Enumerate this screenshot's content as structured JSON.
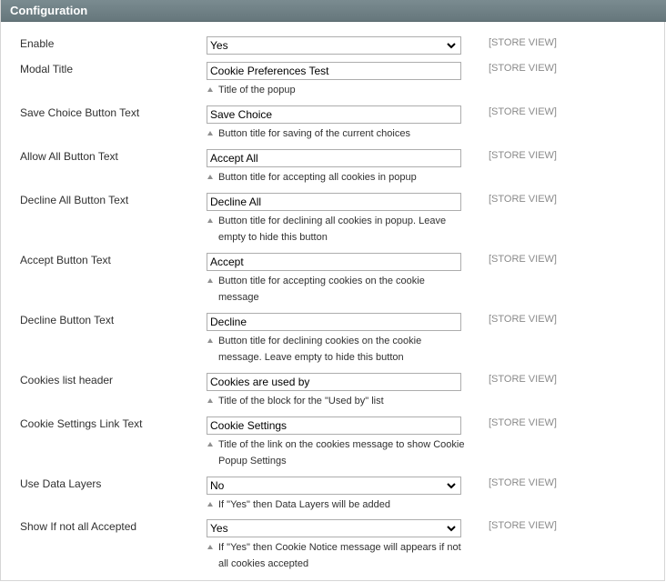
{
  "section": {
    "title": "Configuration"
  },
  "scope_label": "[STORE VIEW]",
  "rows": [
    {
      "label": "Enable",
      "type": "select",
      "value": "Yes",
      "note": ""
    },
    {
      "label": "Modal Title",
      "type": "text",
      "value": "Cookie Preferences Test",
      "note": "Title of the popup"
    },
    {
      "label": "Save Choice Button Text",
      "type": "text",
      "value": "Save Choice",
      "note": "Button title for saving of the current choices"
    },
    {
      "label": "Allow All Button Text",
      "type": "text",
      "value": "Accept All",
      "note": "Button title for accepting all cookies in popup"
    },
    {
      "label": "Decline All Button Text",
      "type": "text",
      "value": "Decline All",
      "note": "Button title for declining all cookies in popup. Leave empty to hide this button"
    },
    {
      "label": "Accept Button Text",
      "type": "text",
      "value": "Accept",
      "note": "Button title for accepting cookies on the cookie message"
    },
    {
      "label": "Decline Button Text",
      "type": "text",
      "value": "Decline",
      "note": "Button title for declining cookies on the cookie message. Leave empty to hide this button"
    },
    {
      "label": "Cookies list header",
      "type": "text",
      "value": "Cookies are used by",
      "note": "Title of the block for the \"Used by\" list"
    },
    {
      "label": "Cookie Settings Link Text",
      "type": "text",
      "value": "Cookie Settings",
      "note": "Title of the link on the cookies message to show Cookie Popup Settings"
    },
    {
      "label": "Use Data Layers",
      "type": "select",
      "value": "No",
      "note": "If \"Yes\" then Data Layers will be added"
    },
    {
      "label": "Show If not all Accepted",
      "type": "select",
      "value": "Yes",
      "note": "If \"Yes\" then Cookie Notice message will appears if not all cookies accepted"
    }
  ]
}
